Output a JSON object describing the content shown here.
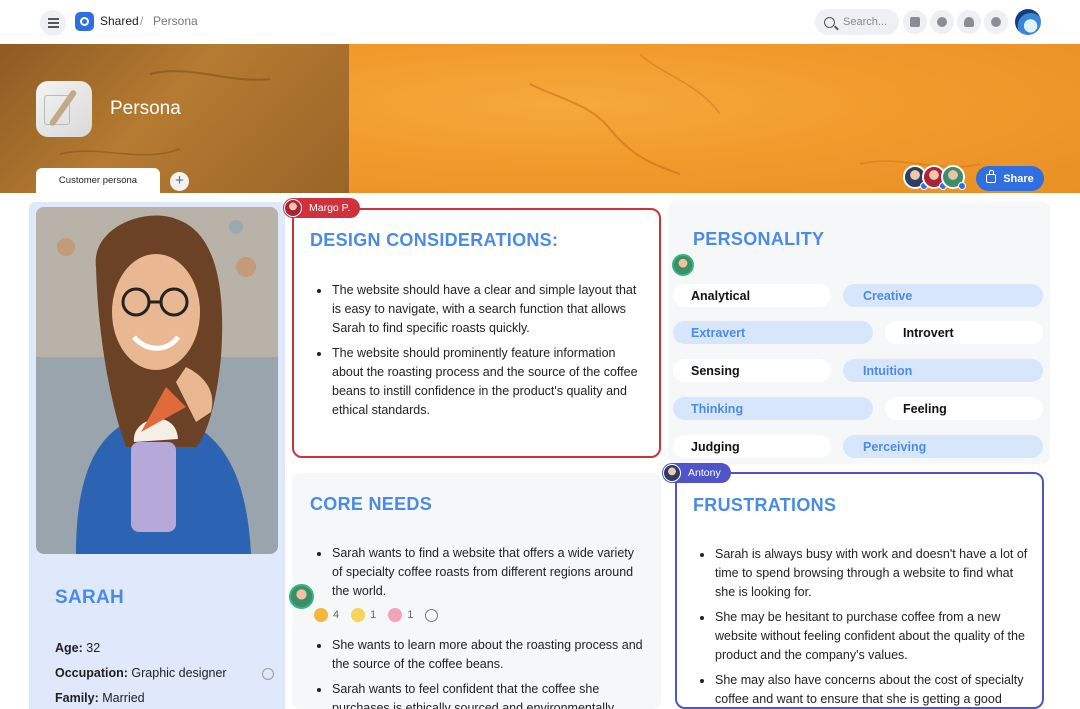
{
  "breadcrumb": {
    "workspace": "Shared",
    "separator": "/",
    "page": "Persona"
  },
  "search": {
    "placeholder": "Search..."
  },
  "header": {
    "title": "Persona"
  },
  "tabs": [
    {
      "label": "Customer persona"
    }
  ],
  "share": {
    "label": "Share"
  },
  "colors": {
    "accent": "#2f6fe0",
    "heading": "#4a8be6",
    "margo": "#d0313c",
    "antony": "#5054c9"
  },
  "profile": {
    "name": "SARAH",
    "fields": [
      {
        "label": "Age:",
        "value": "32"
      },
      {
        "label": "Occupation:",
        "value": "Graphic designer"
      },
      {
        "label": "Family:",
        "value": "Married"
      }
    ]
  },
  "design": {
    "cursor_user": "Margo P.",
    "title": "DESIGN CONSIDERATIONS:",
    "items": [
      "The website should have a clear and simple layout that is easy to navigate, with a search function that allows Sarah to find specific roasts quickly.",
      "The website should prominently feature information about the roasting process and the source of the coffee beans to instill confidence in the product's quality and ethical standards."
    ]
  },
  "personality": {
    "title": "PERSONALITY",
    "traits": [
      {
        "left": "Analytical",
        "right": "Creative",
        "selected": "left"
      },
      {
        "left": "Extravert",
        "right": "Introvert",
        "selected": "right"
      },
      {
        "left": "Sensing",
        "right": "Intuition",
        "selected": "left"
      },
      {
        "left": "Thinking",
        "right": "Feeling",
        "selected": "right"
      },
      {
        "left": "Judging",
        "right": "Perceiving",
        "selected": "left"
      }
    ]
  },
  "core": {
    "title": "CORE NEEDS",
    "items": [
      "Sarah wants to find a website that offers a wide variety of specialty coffee roasts from different regions around the world.",
      "She wants to learn more about the roasting process and the source of the coffee beans.",
      "Sarah wants to feel confident that the coffee she purchases is ethically sourced and environmentally"
    ],
    "reactions": [
      {
        "icon": "thumbs-up-icon",
        "count": "4"
      },
      {
        "icon": "sparkles-icon",
        "count": "1"
      },
      {
        "icon": "flower-icon",
        "count": "1"
      }
    ]
  },
  "frustrations": {
    "cursor_user": "Antony",
    "title": "FRUSTRATIONS",
    "items": [
      "Sarah is always busy with work and doesn't have a lot of time to spend browsing through a website to find what she is looking for.",
      "She may be hesitant to purchase coffee from a new website without feeling confident about the quality of the product and the company's values.",
      "She may also have concerns about the cost of specialty coffee and want to ensure that she is getting a good"
    ]
  }
}
